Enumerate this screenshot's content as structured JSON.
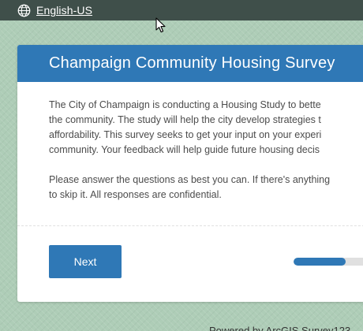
{
  "topbar": {
    "language_icon": "globe-icon",
    "language_label": "English-US"
  },
  "survey": {
    "title": "Champaign Community Housing Survey",
    "intro_lines": [
      "The City of Champaign is conducting a Housing Study to bette",
      "the community. The study will help the city develop strategies t",
      "affordability. This survey seeks to get your input on your experi",
      "community. Your feedback will help guide future housing decis"
    ],
    "instruction_lines": [
      "Please answer the questions as best you can. If there's anything",
      "to skip it. All responses are confidential."
    ],
    "next_label": "Next",
    "progress_fraction": 0.6
  },
  "footer": {
    "powered_by": "Powered by ArcGIS Survey123"
  },
  "colors": {
    "accent": "#2f78b6",
    "topbar": "#3f4f4a",
    "background": "#aecdb7"
  }
}
